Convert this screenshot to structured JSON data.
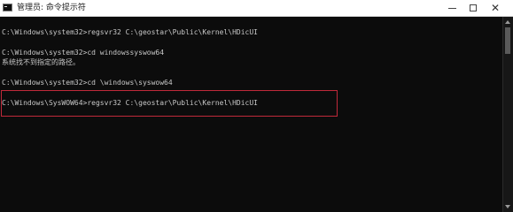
{
  "window": {
    "title": "管理员: 命令提示符",
    "icon": "cmd-icon",
    "controls": {
      "minimize": "minimize-icon",
      "maximize": "maximize-icon",
      "close_glyph": "✕"
    }
  },
  "console": {
    "lines": [
      "C:\\Windows\\system32>regsvr32 C:\\geostar\\Public\\Kernel\\HDicUI",
      "C:\\Windows\\system32>cd windowssyswow64",
      "系统找不到指定的路径。",
      "C:\\Windows\\system32>cd \\windows\\syswow64",
      "C:\\Windows\\SysWOW64>regsvr32 C:\\geostar\\Public\\Kernel\\HDicUI"
    ],
    "highlight_color": "#c0293a",
    "text_color": "#c8c8c8",
    "background_color": "#0c0c0c"
  }
}
